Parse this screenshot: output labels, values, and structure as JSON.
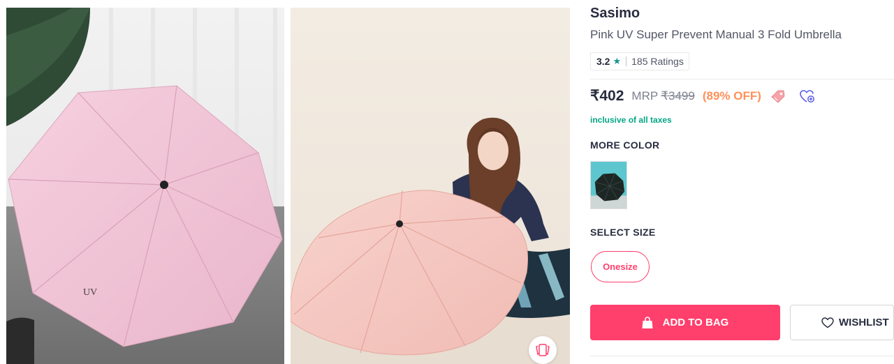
{
  "product": {
    "brand": "Sasimo",
    "title": "Pink UV Super Prevent Manual 3 Fold Umbrella",
    "rating": {
      "score": "3.2",
      "star": "★",
      "count": "185 Ratings"
    },
    "price": {
      "selling": "₹402",
      "mrp_label": "MRP",
      "mrp": "₹3499",
      "discount": "(89% OFF)"
    },
    "tax_note": "inclusive of all taxes"
  },
  "gallery": {
    "images": [
      {
        "name": "pink-umbrella-closeup",
        "print": "UV"
      },
      {
        "name": "model-with-pink-umbrella"
      }
    ],
    "similar_icon": "similar-products-icon"
  },
  "more_color": {
    "title": "MORE COLOR",
    "swatches": [
      {
        "name": "black-umbrella-variant"
      }
    ]
  },
  "select_size": {
    "title": "SELECT SIZE",
    "sizes": [
      "Onesize"
    ]
  },
  "actions": {
    "add_to_bag": "ADD TO BAG",
    "wishlist": "WISHLIST"
  },
  "colors": {
    "accent": "#ff3f6c",
    "discount": "#ff905a",
    "tax": "#03a685",
    "rating_star": "#14958f",
    "umbrella_pink": "#f2c4d6"
  }
}
